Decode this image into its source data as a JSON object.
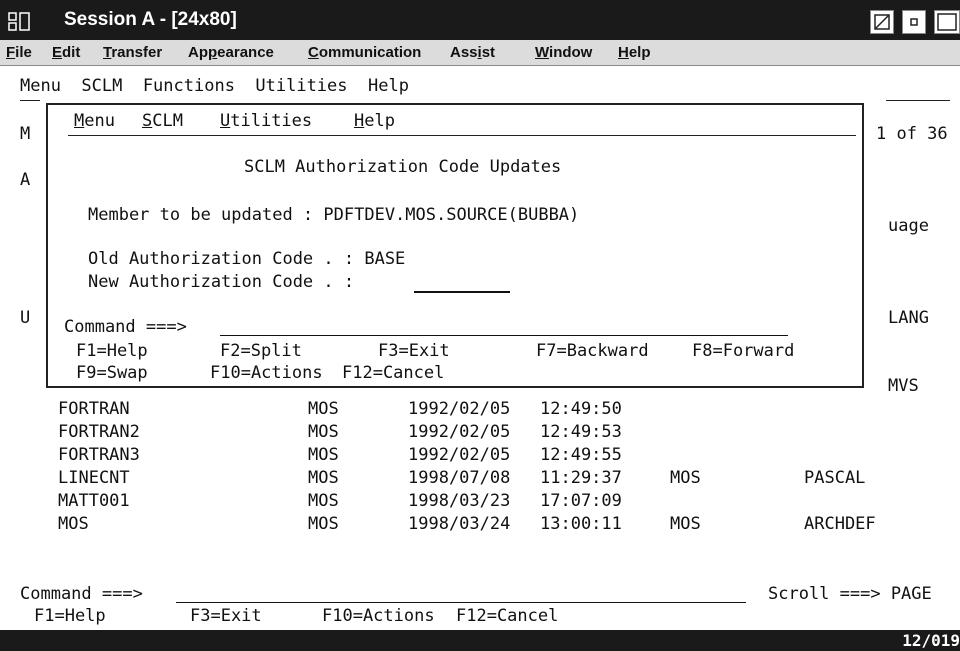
{
  "window": {
    "title": "Session A - [24x80]",
    "status_right": "12/019"
  },
  "menubar": {
    "items": [
      {
        "label": "File",
        "ul": "F",
        "rest": "ile"
      },
      {
        "label": "Edit",
        "ul": "E",
        "rest": "dit"
      },
      {
        "label": "Transfer",
        "ul": "T",
        "rest": "ransfer"
      },
      {
        "label": "Appearance",
        "pre": "Ap",
        "ul": "p",
        "rest": "earance"
      },
      {
        "label": "Communication",
        "ul": "C",
        "rest": "ommunication"
      },
      {
        "label": "Assist",
        "pre": "Ass",
        "ul": "i",
        "rest": "st"
      },
      {
        "label": "Window",
        "ul": "W",
        "rest": "indow"
      },
      {
        "label": "Help",
        "ul": "H",
        "rest": "elp"
      }
    ]
  },
  "terminal": {
    "action_bar": "Menu  SCLM  Functions  Utilities  Help",
    "left_fragments": [
      "M",
      "A",
      "U"
    ],
    "right_fragments": [
      "1 of 36",
      "uage",
      "LANG",
      "MVS"
    ],
    "rows": [
      {
        "member": "FORTRAN",
        "owner": "MOS",
        "date": "1992/02/05",
        "time": "12:49:50",
        "c5": "",
        "c6": ""
      },
      {
        "member": "FORTRAN2",
        "owner": "MOS",
        "date": "1992/02/05",
        "time": "12:49:53",
        "c5": "",
        "c6": ""
      },
      {
        "member": "FORTRAN3",
        "owner": "MOS",
        "date": "1992/02/05",
        "time": "12:49:55",
        "c5": "",
        "c6": ""
      },
      {
        "member": "LINECNT",
        "owner": "MOS",
        "date": "1998/07/08",
        "time": "11:29:37",
        "c5": "MOS",
        "c6": "PASCAL"
      },
      {
        "member": "MATT001",
        "owner": "MOS",
        "date": "1998/03/23",
        "time": "17:07:09",
        "c5": "",
        "c6": ""
      },
      {
        "member": "MOS",
        "owner": "MOS",
        "date": "1998/03/24",
        "time": "13:00:11",
        "c5": "MOS",
        "c6": "ARCHDEF"
      }
    ],
    "command_label": "Command ===>",
    "scroll_text": "Scroll ===> PAGE",
    "fkeys": [
      "F1=Help",
      "F3=Exit",
      "F10=Actions",
      "F12=Cancel"
    ]
  },
  "popup": {
    "menu": [
      {
        "ul": "M",
        "rest": "enu"
      },
      {
        "ul": "S",
        "rest": "CLM"
      },
      {
        "ul": "U",
        "rest": "tilities"
      },
      {
        "ul": "H",
        "rest": "elp"
      }
    ],
    "title": "SCLM Authorization Code Updates",
    "member_label": "Member to be updated : ",
    "member_value": "PDFTDEV.MOS.SOURCE(BUBBA)",
    "old_label": "Old Authorization Code . : ",
    "old_value": "BASE",
    "new_label": "New Authorization Code . : ",
    "new_value": "",
    "command_label": "Command ===>",
    "fkeys_row1": [
      "F1=Help",
      "F2=Split",
      "F3=Exit",
      "F7=Backward",
      "F8=Forward"
    ],
    "fkeys_row2": [
      "F9=Swap",
      "F10=Actions",
      "F12=Cancel"
    ]
  }
}
